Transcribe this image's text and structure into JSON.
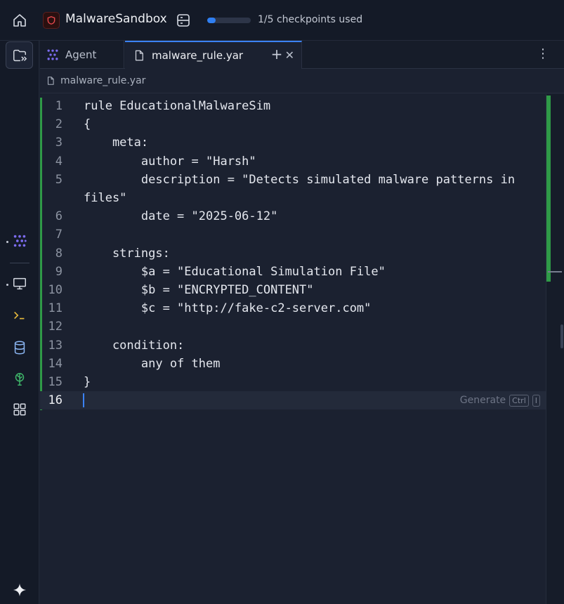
{
  "app": {
    "title": "MalwareSandbox",
    "checkpoints": {
      "text": "1/5 checkpoints used",
      "used": 1,
      "total": 5
    }
  },
  "tabs": [
    {
      "label": "Agent"
    },
    {
      "label": "malware_rule.yar",
      "close": "✕"
    }
  ],
  "add_tab_label": "+",
  "more_label": "⋮",
  "breadcrumb": {
    "label": "malware_rule.yar"
  },
  "editor": {
    "lines": [
      {
        "num": "1",
        "code": "rule EducationalMalwareSim"
      },
      {
        "num": "2",
        "code": "{"
      },
      {
        "num": "3",
        "code": "    meta:"
      },
      {
        "num": "4",
        "code": "        author = \"Harsh\""
      },
      {
        "num": "5",
        "code": "        description = \"Detects simulated malware patterns in"
      },
      {
        "num": "",
        "code": "files\""
      },
      {
        "num": "6",
        "code": "        date = \"2025-06-12\""
      },
      {
        "num": "7",
        "code": ""
      },
      {
        "num": "8",
        "code": "    strings:"
      },
      {
        "num": "9",
        "code": "        $a = \"Educational Simulation File\""
      },
      {
        "num": "10",
        "code": "        $b = \"ENCRYPTED_CONTENT\""
      },
      {
        "num": "11",
        "code": "        $c = \"http://fake-c2-server.com\""
      },
      {
        "num": "12",
        "code": ""
      },
      {
        "num": "13",
        "code": "    condition:"
      },
      {
        "num": "14",
        "code": "        any of them"
      },
      {
        "num": "15",
        "code": "}"
      },
      {
        "num": "16",
        "code": ""
      }
    ],
    "generate_hint": {
      "label": "Generate",
      "key1": "Ctrl",
      "key2": "I"
    }
  },
  "icons": {
    "home": "home-icon",
    "logo": "shield-icon",
    "checkpoint": "server-icon",
    "explorer": "folder-arrow-icon",
    "agent": "agent-icon",
    "monitor": "monitor-icon",
    "terminal": "terminal-icon",
    "database": "database-icon",
    "network": "tree-icon",
    "grid": "grid-icon",
    "sparkle": "sparkle-icon",
    "file": "file-icon"
  },
  "colors": {
    "accent": "#3b82f6",
    "git_added": "#2f9a47",
    "agent_purple": "#7c6cf0",
    "logo_red": "#e5484d"
  }
}
